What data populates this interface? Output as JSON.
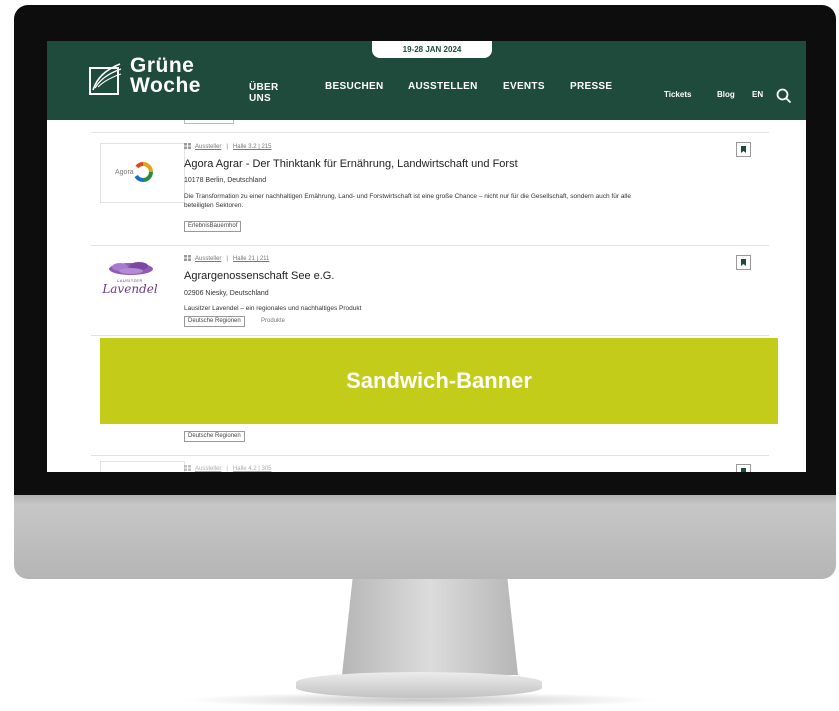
{
  "header": {
    "date": "19-28 JAN 2024",
    "logo_line1": "Grüne",
    "logo_line2": "Woche",
    "nav": {
      "ueber_line1": "ÜBER",
      "ueber_line2": "UNS",
      "besuchen": "BESUCHEN",
      "ausstellen": "AUSSTELLEN",
      "events": "EVENTS",
      "presse": "PRESSE"
    },
    "tickets": "Tickets",
    "blog": "Blog",
    "lang": "EN"
  },
  "colors": {
    "header_bg": "#1f4b3c",
    "banner_bg": "#c4cc1a"
  },
  "exhibitors": [
    {
      "type": "Aussteller",
      "hall": "Halle 3.2 | 215",
      "name": "Agora Agrar - Der Thinktank für Ernährung, Landwirtschaft und Forst",
      "location": "10178 Berlin, Deutschland",
      "description": "Die Transformation zu einer nachhaltigen Ernährung, Land- und Forstwirtschaft ist eine große Chance – nicht nur für die Gesellschaft, sondern auch für alle beteiligten Sektoren.",
      "tag": "ErlebnisBauernhof",
      "logo_text": "Agora"
    },
    {
      "type": "Aussteller",
      "hall": "Halle 21 | 211",
      "name": "Agrargenossenschaft See e.G.",
      "location": "02906 Niesky, Deutschland",
      "description": "Lausitzer Lavendel – ein regionales und nachhaltiges Produkt",
      "tag": "Deutsche Regionen",
      "tag2": "Produkte",
      "logo_small": "LAUSITZER",
      "logo_script": "Lavendel"
    }
  ],
  "hidden_row_tag": "Deutsche Regionen",
  "next_row": {
    "type": "Aussteller",
    "hall": "Halle 4.2 | 305"
  },
  "banner": {
    "text": "Sandwich-Banner"
  }
}
